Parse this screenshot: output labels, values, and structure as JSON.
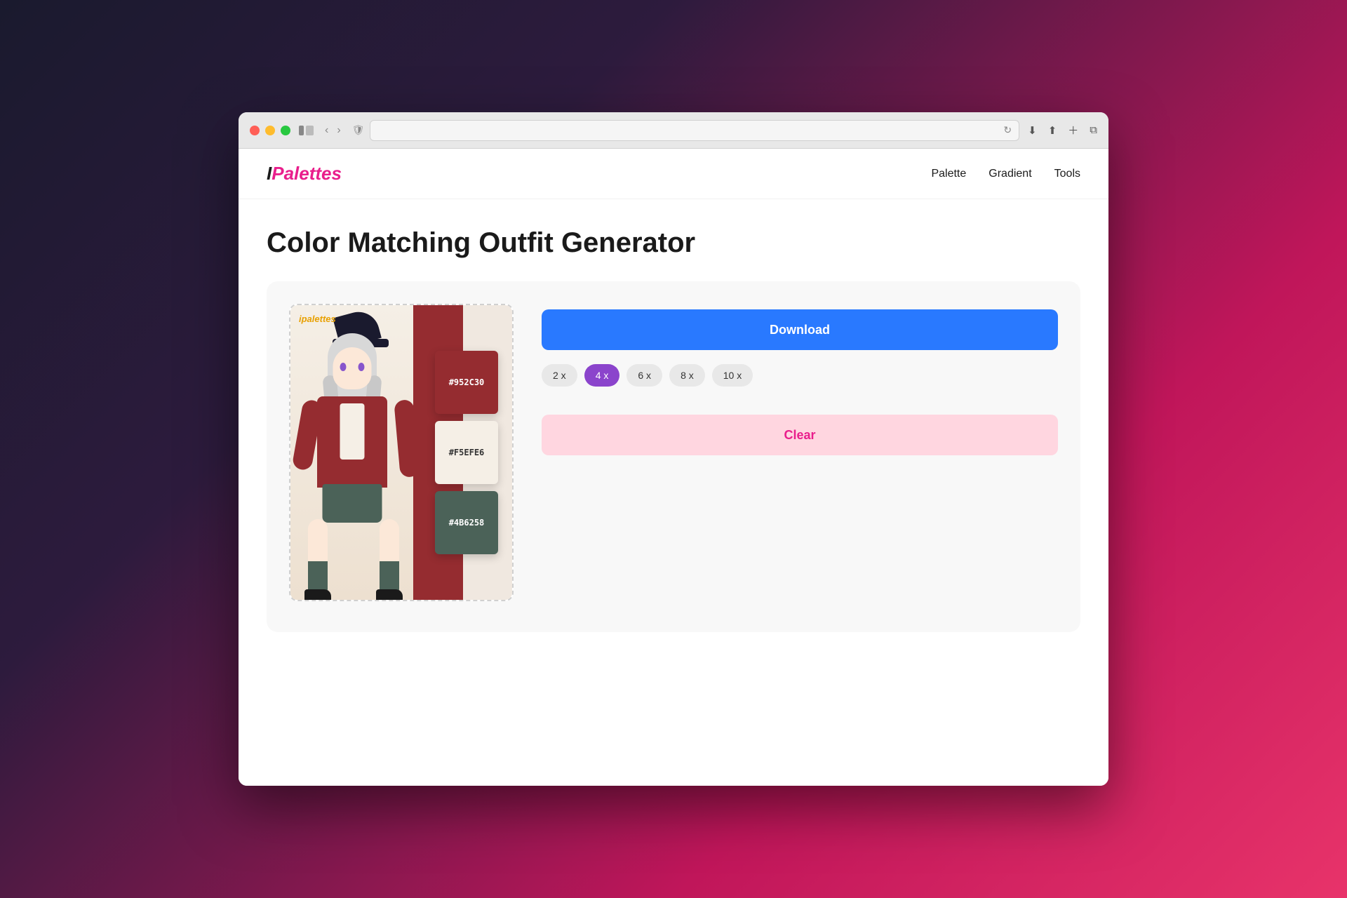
{
  "browser": {
    "address": "",
    "reload_icon": "↻"
  },
  "nav": {
    "logo_i": "I",
    "logo_palettes": "Palettes",
    "links": [
      "Palette",
      "Gradient",
      "Tools"
    ]
  },
  "page": {
    "title": "Color Matching Outfit Generator"
  },
  "palette": {
    "watermark": "ipalettes",
    "colors": [
      {
        "hex": "#952C30",
        "label": "#952C30",
        "dark_text": false
      },
      {
        "hex": "#F5EFE6",
        "label": "#F5EFE6",
        "dark_text": true
      },
      {
        "hex": "#4B6258",
        "label": "#4B6258",
        "dark_text": false
      }
    ]
  },
  "controls": {
    "download_label": "Download",
    "clear_label": "Clear",
    "count_options": [
      "2 x",
      "4 x",
      "6 x",
      "8 x",
      "10 x"
    ],
    "active_count": "4 x"
  }
}
